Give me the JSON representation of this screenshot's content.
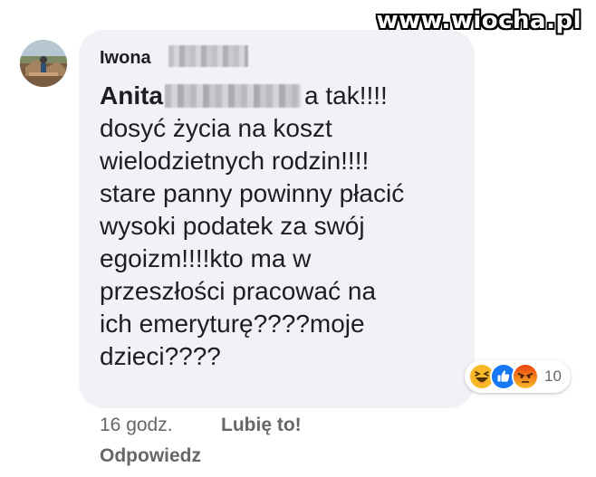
{
  "watermark": "www.wiocha.pl",
  "comment": {
    "author": "Iwona",
    "mention": "Anita",
    "lines": {
      "l1_suffix": "a tak!!!!",
      "l2": "dosyć życia na koszt",
      "l3": "wielodzietnych rodzin!!!!",
      "l4": "stare panny powinny płacić",
      "l5": "wysoki podatek za swój",
      "l6": "egoizm!!!!kto ma w",
      "l7": "przeszłości pracować na",
      "l8": "ich emeryturę????moje",
      "l9": "dzieci????"
    }
  },
  "reactions": {
    "icons": [
      "haha-icon",
      "like-icon",
      "angry-icon"
    ],
    "count": "10"
  },
  "actions": {
    "time": "16 godz.",
    "like_label": "Lubię to!",
    "reply_label": "Odpowiedz"
  },
  "colors": {
    "bubble": "#f0f2f5",
    "meta_text": "#65676b",
    "like_blue": "#1877f2",
    "haha_yellow": "#f7b928",
    "angry_orange": "#e9710f"
  }
}
